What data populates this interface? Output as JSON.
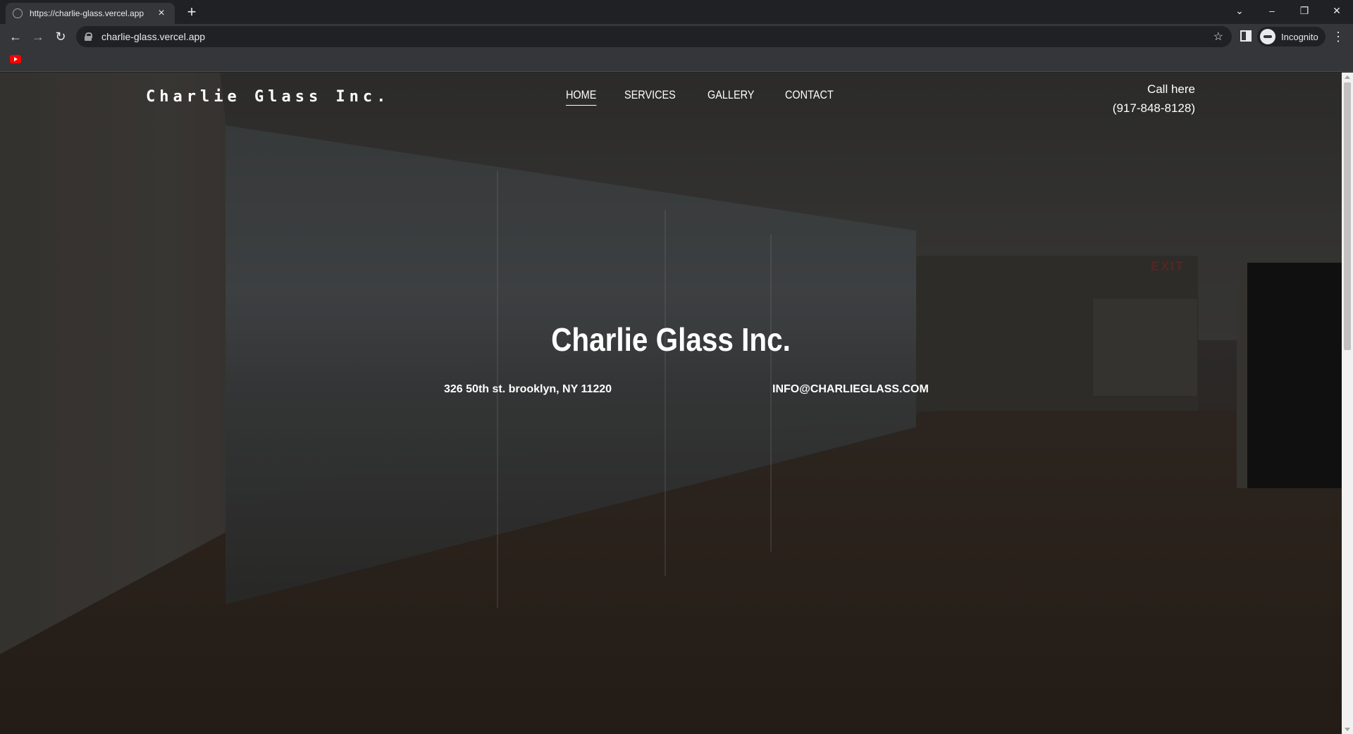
{
  "browser": {
    "tab_title": "https://charlie-glass.vercel.app",
    "url": "charlie-glass.vercel.app",
    "profile_label": "Incognito"
  },
  "site": {
    "brand": "Charlie Glass Inc.",
    "nav": {
      "home": "HOME",
      "services": "SERVICES",
      "gallery": "GALLERY",
      "contact": "CONTACT"
    },
    "call_label": "Call here",
    "phone": "(917-848-8128)",
    "hero_title": "Charlie Glass Inc.",
    "address": "326 50th st. brooklyn, NY 11220",
    "email": "INFO@CHARLIEGLASS.COM"
  },
  "colors": {
    "chrome_dark": "#202124",
    "chrome_toolbar": "#35363a",
    "text_white": "#ffffff"
  },
  "icons": [
    "globe-icon",
    "close-icon",
    "plus-icon",
    "back-icon",
    "forward-icon",
    "reload-icon",
    "lock-icon",
    "star-icon",
    "side-panel-icon",
    "incognito-icon",
    "menu-icon",
    "youtube-icon"
  ]
}
